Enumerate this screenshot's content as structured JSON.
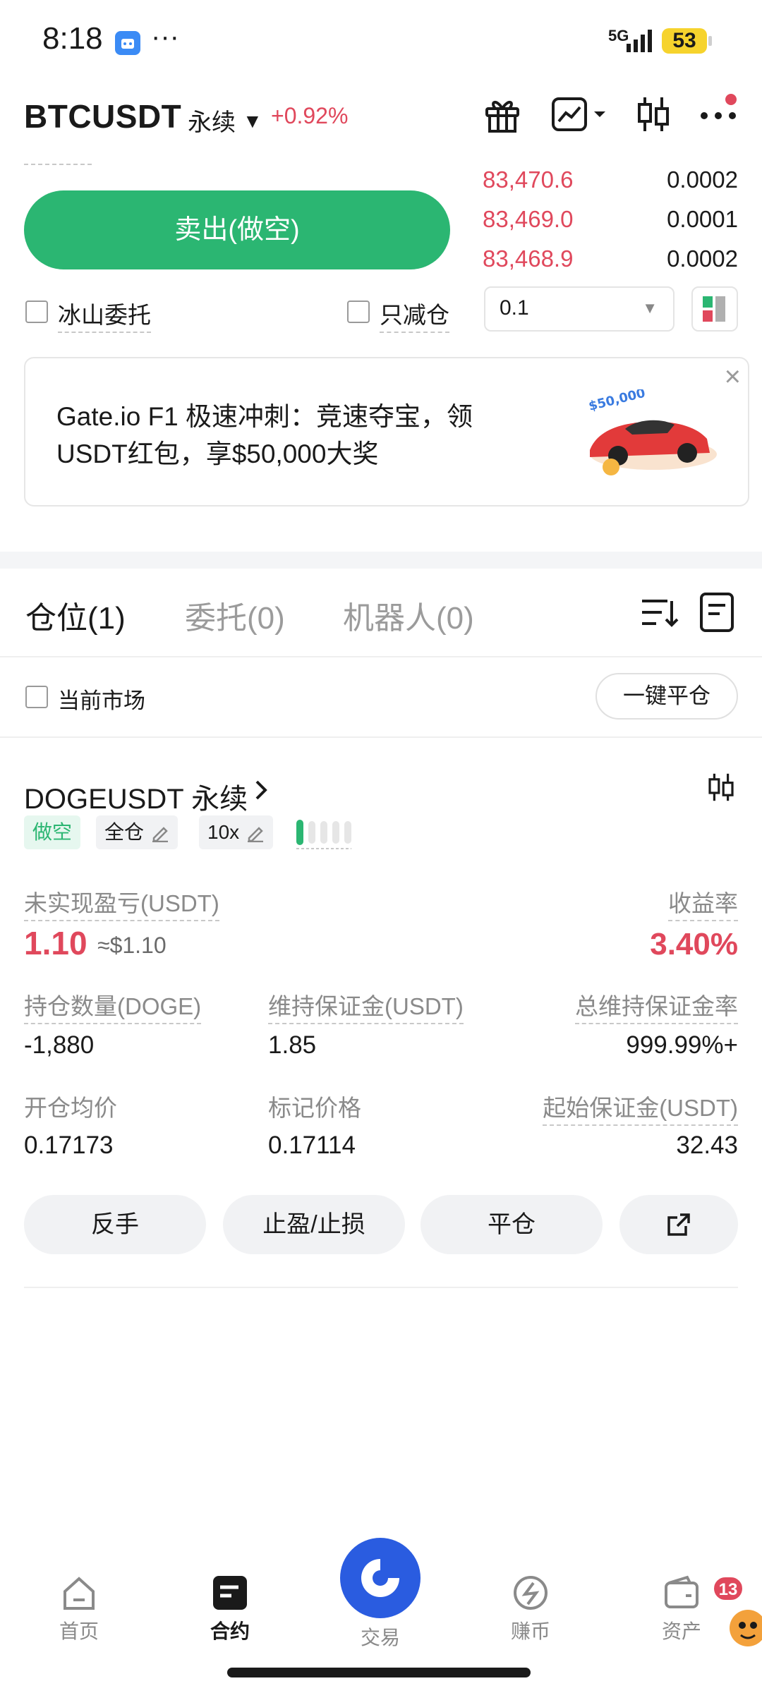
{
  "status_bar": {
    "time": "8:18",
    "overflow": "···",
    "network": "5G",
    "battery": "53"
  },
  "header": {
    "pair": "BTCUSDT",
    "type": "永续",
    "change": "+0.92%"
  },
  "order_book": [
    {
      "price": "83,470.6",
      "qty": "0.0002"
    },
    {
      "price": "83,469.0",
      "qty": "0.0001"
    },
    {
      "price": "83,468.9",
      "qty": "0.0002"
    }
  ],
  "trade": {
    "sell_label": "卖出(做空)",
    "iceberg_label": "冰山委托",
    "reduce_only_label": "只减仓",
    "quantity": "0.1"
  },
  "banner": {
    "text": "Gate.io F1 极速冲刺：竞速夺宝，领USDT红包，享$50,000大奖",
    "close": "×"
  },
  "tabs": [
    {
      "label": "仓位(1)"
    },
    {
      "label": "委托(0)"
    },
    {
      "label": "机器人(0)"
    }
  ],
  "filter": {
    "current_market_label": "当前市场",
    "close_all_label": "一键平仓"
  },
  "position": {
    "symbol": "DOGEUSDT 永续",
    "side": "做空",
    "margin_mode": "全仓",
    "leverage": "10x",
    "leverage_level": 0.2,
    "unrealized_pnl_label": "未实现盈亏(USDT)",
    "unrealized_pnl": "1.10",
    "unrealized_pnl_usd": "≈$1.10",
    "roe_label": "收益率",
    "roe": "3.40%",
    "size_label": "持仓数量(DOGE)",
    "size": "-1,880",
    "maint_margin_label": "维持保证金(USDT)",
    "maint_margin": "1.85",
    "maint_rate_label": "总维持保证金率",
    "maint_rate": "999.99%+",
    "entry_label": "开仓均价",
    "entry": "0.17173",
    "mark_label": "标记价格",
    "mark": "0.17114",
    "init_margin_label": "起始保证金(USDT)",
    "init_margin": "32.43"
  },
  "actions": {
    "reverse": "反手",
    "tpsl": "止盈/止损",
    "close": "平仓"
  },
  "nav": [
    {
      "label": "首页"
    },
    {
      "label": "合约"
    },
    {
      "label": "交易"
    },
    {
      "label": "赚币"
    },
    {
      "label": "资产"
    }
  ],
  "nav_badge": "13"
}
